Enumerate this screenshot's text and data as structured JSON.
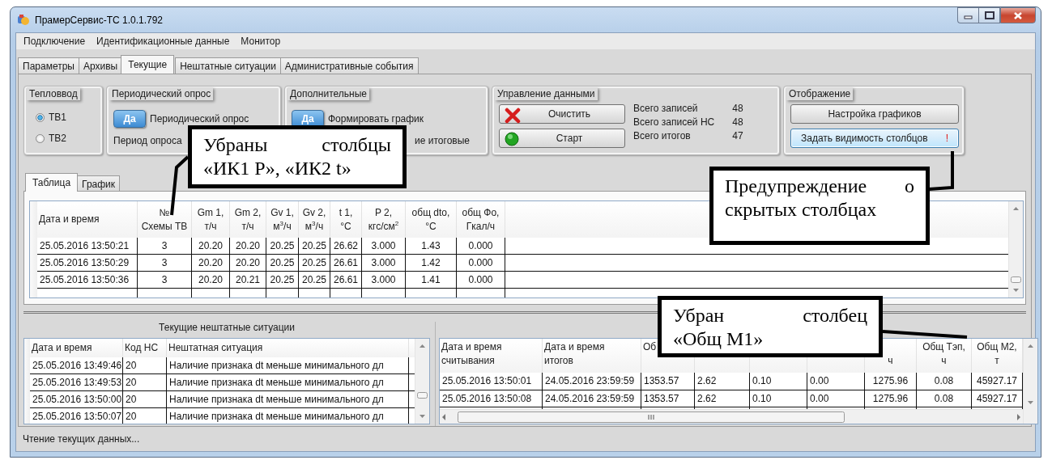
{
  "window": {
    "title": "ПрамерСервис-ТС 1.0.1.792"
  },
  "menu": [
    "Подключение",
    "Идентификационные данные",
    "Монитор"
  ],
  "tabs": [
    {
      "label": "Параметры",
      "selected": false
    },
    {
      "label": "Архивы",
      "selected": false
    },
    {
      "label": "Текущие",
      "selected": true
    },
    {
      "label": "Нештатные ситуации",
      "selected": false
    },
    {
      "label": "Административные события",
      "selected": false
    }
  ],
  "heat_input": {
    "title": "Тепловвод",
    "options": [
      {
        "label": "ТВ1",
        "selected": true
      },
      {
        "label": "ТВ2",
        "selected": false
      }
    ]
  },
  "periodic_poll": {
    "title": "Периодический опрос",
    "toggle": {
      "label": "Да",
      "on": true
    },
    "toggle_caption": "Периодический опрос",
    "period_label": "Период опроса"
  },
  "additional": {
    "title": "Дополнительные",
    "toggle": {
      "label": "Да",
      "on": true
    },
    "toggle_caption": "Формировать график",
    "caption_2": "ие итоговые"
  },
  "data_control": {
    "title": "Управление данными",
    "buttons": [
      {
        "label": "Очистить",
        "kind": "clear"
      },
      {
        "label": "Старт",
        "kind": "start"
      }
    ],
    "stats": [
      {
        "label": "Всего записей",
        "value": "48"
      },
      {
        "label": "Всего записей НС",
        "value": "48"
      },
      {
        "label": "Всего итогов",
        "value": "47"
      }
    ]
  },
  "display": {
    "title": "Отображение",
    "buttons": [
      {
        "label": "Настройка графиков",
        "focused": false
      },
      {
        "label": "Задать видимость столбцов",
        "focused": true,
        "warning": "!"
      }
    ]
  },
  "view_tabs": [
    {
      "label": "Таблица",
      "selected": true
    },
    {
      "label": "График",
      "selected": false
    }
  ],
  "current_table": {
    "columns": [
      "Дата и время",
      "№\nСхемы ТВ",
      "Gm 1,\nт/ч",
      "Gm 2,\nт/ч",
      "Gv 1,\nм$^{3}$/ч",
      "Gv 2,\nм$^{3}$/ч",
      "t 1,\n°C",
      "P 2,\nкгс/см$^{2}$",
      "общ dto,\n°C",
      "общ Фо,\nГкал/ч"
    ],
    "rows": [
      [
        "25.05.2016 13:50:21",
        "3",
        "20.20",
        "20.20",
        "20.25",
        "20.25",
        "26.62",
        "3.000",
        "1.43",
        "0.000"
      ],
      [
        "25.05.2016 13:50:29",
        "3",
        "20.20",
        "20.20",
        "20.25",
        "20.25",
        "26.61",
        "3.000",
        "1.42",
        "0.000"
      ],
      [
        "25.05.2016 13:50:36",
        "3",
        "20.20",
        "20.21",
        "20.25",
        "20.25",
        "26.61",
        "3.000",
        "1.41",
        "0.000"
      ]
    ]
  },
  "incidents": {
    "title": "Текущие нештатные ситуации",
    "columns": [
      "Дата и время",
      "Код НС",
      "Нештатная ситуация"
    ],
    "rows": [
      [
        "25.05.2016 13:49:46",
        "20",
        "Наличие признака dt меньше минимального дл"
      ],
      [
        "25.05.2016 13:49:53",
        "20",
        "Наличие признака dt меньше минимального дл"
      ],
      [
        "25.05.2016 13:50:00",
        "20",
        "Наличие признака dt меньше минимального дл"
      ],
      [
        "25.05.2016 13:50:07",
        "20",
        "Наличие признака dt меньше минимального дл"
      ]
    ]
  },
  "totals": {
    "columns": [
      {
        "line_1": "Дата и время",
        "line_2": "считывания"
      },
      {
        "line_1": "Дата и время",
        "line_2": "итогов"
      },
      {
        "line_1": "Об"
      },
      {},
      {},
      {},
      {
        "line_2": "ч"
      },
      {
        "line_1": "Общ Тэп,",
        "line_2": "ч"
      },
      {
        "line_1": "Общ М2,",
        "line_2": "т"
      }
    ],
    "rows": [
      [
        "25.05.2016 13:50:01",
        "24.05.2016 23:59:59",
        "1353.57",
        "2.62",
        "0.10",
        "0.00",
        "1275.96",
        "0.08",
        "45927.17"
      ],
      [
        "25.05.2016 13:50:08",
        "24.05.2016 23:59:59",
        "1353.57",
        "2.62",
        "0.10",
        "0.00",
        "1275.96",
        "0.08",
        "45927.17"
      ]
    ]
  },
  "status_bar": "Чтение текущих данных...",
  "callouts": [
    {
      "text": "Убраны столбцы\n«ИК1 P», «ИК2 t»"
    },
    {
      "text": "Предупреждение о\nскрытых столбцах"
    },
    {
      "text": "Убран столбец\n«Общ М1»"
    }
  ]
}
